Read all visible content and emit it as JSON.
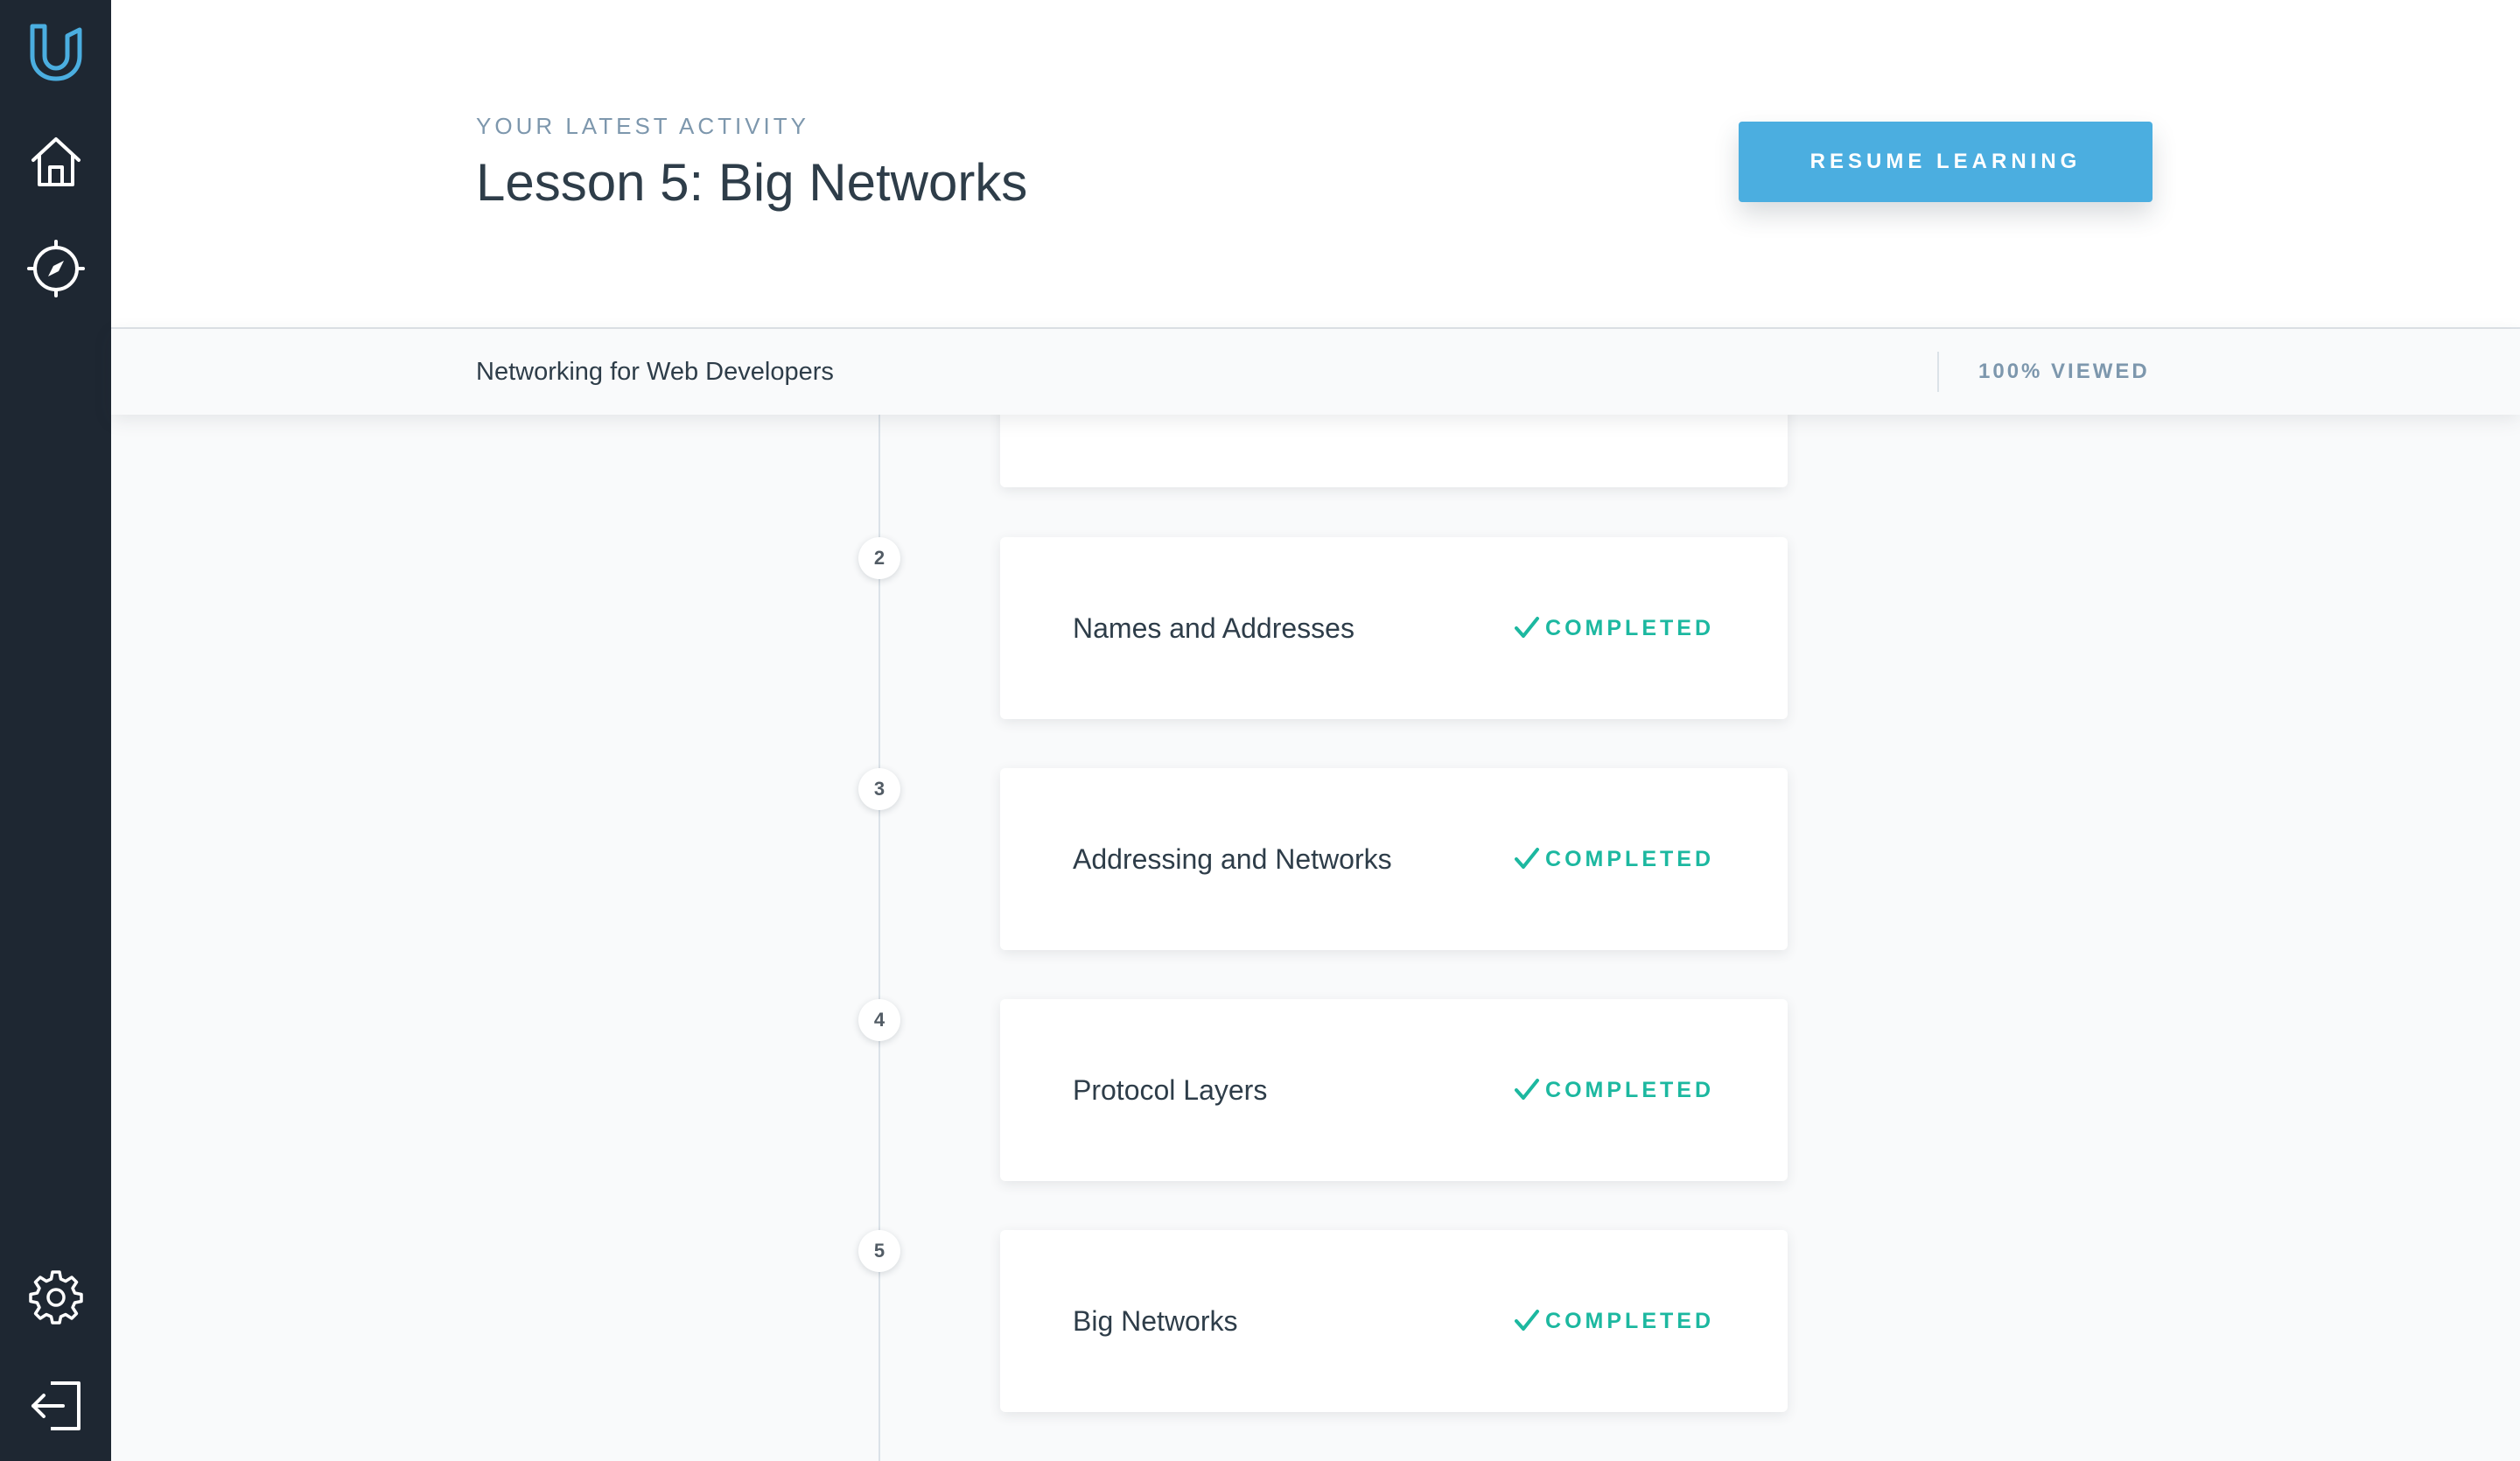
{
  "sidebar": {
    "icons": [
      {
        "name": "udacity-logo-icon"
      },
      {
        "name": "home-icon"
      },
      {
        "name": "compass-icon"
      },
      {
        "name": "gear-icon"
      },
      {
        "name": "logout-icon"
      }
    ],
    "accent_color": "#4baee0"
  },
  "header": {
    "eyebrow": "YOUR LATEST ACTIVITY",
    "title": "Lesson 5: Big Networks",
    "resume_label": "RESUME LEARNING"
  },
  "course_bar": {
    "course_name": "Networking for Web Developers",
    "progress_label": "100% VIEWED"
  },
  "lessons": [
    {
      "number": "2",
      "title": "Names and Addresses",
      "status": "COMPLETED"
    },
    {
      "number": "3",
      "title": "Addressing and Networks",
      "status": "COMPLETED"
    },
    {
      "number": "4",
      "title": "Protocol Layers",
      "status": "COMPLETED"
    },
    {
      "number": "5",
      "title": "Big Networks",
      "status": "COMPLETED"
    }
  ],
  "colors": {
    "sidebar_bg": "#1e2732",
    "button_bg": "#4baee0",
    "completed": "#1cb8a0",
    "eyebrow": "#7d97ad"
  }
}
